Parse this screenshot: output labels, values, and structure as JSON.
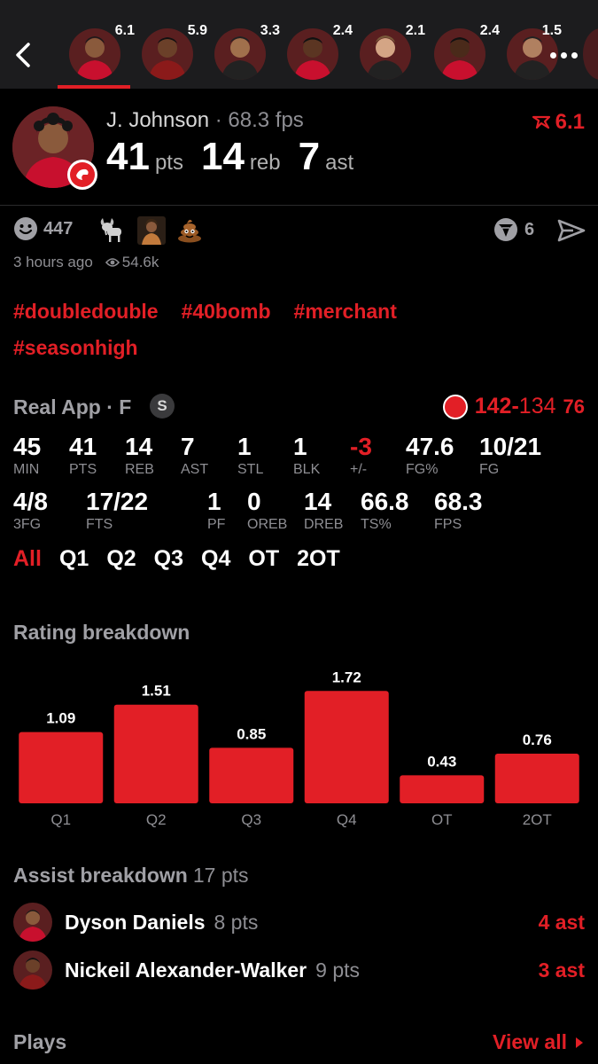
{
  "top_strip": {
    "players": [
      {
        "rating": "6.1",
        "selected": true
      },
      {
        "rating": "5.9"
      },
      {
        "rating": "3.3"
      },
      {
        "rating": "2.4"
      },
      {
        "rating": "2.1"
      },
      {
        "rating": "2.4"
      },
      {
        "rating": "1.5"
      }
    ]
  },
  "header": {
    "name": "J. Johnson",
    "separator": " · ",
    "fps": "68.3 fps",
    "pts": "41",
    "pts_label": "pts",
    "reb": "14",
    "reb_label": "reb",
    "ast": "7",
    "ast_label": "ast",
    "rating": "6.1"
  },
  "reactions": {
    "smiley_count": "447",
    "icons": [
      "smiley-icon",
      "goat-icon",
      "person-photo-icon",
      "poop-icon"
    ],
    "votes_count": "6",
    "time_ago": "3 hours ago",
    "views": "54.6k"
  },
  "hashtags": [
    "#doubledouble",
    "#40bomb",
    "#merchant",
    "#seasonhigh"
  ],
  "game": {
    "label": "Real App · F",
    "badge": "S",
    "team_score": "142",
    "dash": "-",
    "opp_score": "134",
    "opp_logo_text": "76"
  },
  "box_score": {
    "row1": [
      {
        "value": "45",
        "label": "MIN"
      },
      {
        "value": "41",
        "label": "PTS"
      },
      {
        "value": "14",
        "label": "REB"
      },
      {
        "value": "7",
        "label": "AST"
      },
      {
        "value": "1",
        "label": "STL"
      },
      {
        "value": "1",
        "label": "BLK"
      },
      {
        "value": "-3",
        "label": "+/-"
      },
      {
        "value": "47.6",
        "label": "FG%"
      },
      {
        "value": "10/21",
        "label": "FG"
      }
    ],
    "row2": [
      {
        "value": "4/8",
        "label": "3FG"
      },
      {
        "value": "17/22",
        "label": "FTS"
      },
      {
        "value": "1",
        "label": "PF"
      },
      {
        "value": "0",
        "label": "OREB"
      },
      {
        "value": "14",
        "label": "DREB"
      },
      {
        "value": "66.8",
        "label": "TS%"
      },
      {
        "value": "68.3",
        "label": "FPS"
      }
    ]
  },
  "quarter_tabs": [
    "All",
    "Q1",
    "Q2",
    "Q3",
    "Q4",
    "OT",
    "2OT"
  ],
  "rating_breakdown": {
    "title": "Rating breakdown"
  },
  "chart_data": {
    "type": "bar",
    "title": "Rating breakdown",
    "categories": [
      "Q1",
      "Q2",
      "Q3",
      "Q4",
      "OT",
      "2OT"
    ],
    "values": [
      1.09,
      1.51,
      0.85,
      1.72,
      0.43,
      0.76
    ],
    "value_labels": [
      "1.09",
      "1.51",
      "0.85",
      "1.72",
      "0.43",
      "0.76"
    ],
    "ylim": [
      0,
      1.9
    ],
    "grid": false,
    "bar_color": "#e21f26"
  },
  "assist_breakdown": {
    "title": "Assist breakdown",
    "total": "17 pts",
    "rows": [
      {
        "name": "Dyson Daniels",
        "pts": "8 pts",
        "ast": "4 ast"
      },
      {
        "name": "Nickeil Alexander-Walker",
        "pts": "9 pts",
        "ast": "3 ast"
      }
    ]
  },
  "plays": {
    "title": "Plays",
    "view_all": "View all"
  },
  "colors": {
    "accent": "#e21f26",
    "background": "#000000",
    "strip_background": "#1c1c1e",
    "muted_text": "#8e8e93",
    "sixers_blue": "#1d4fd6"
  }
}
